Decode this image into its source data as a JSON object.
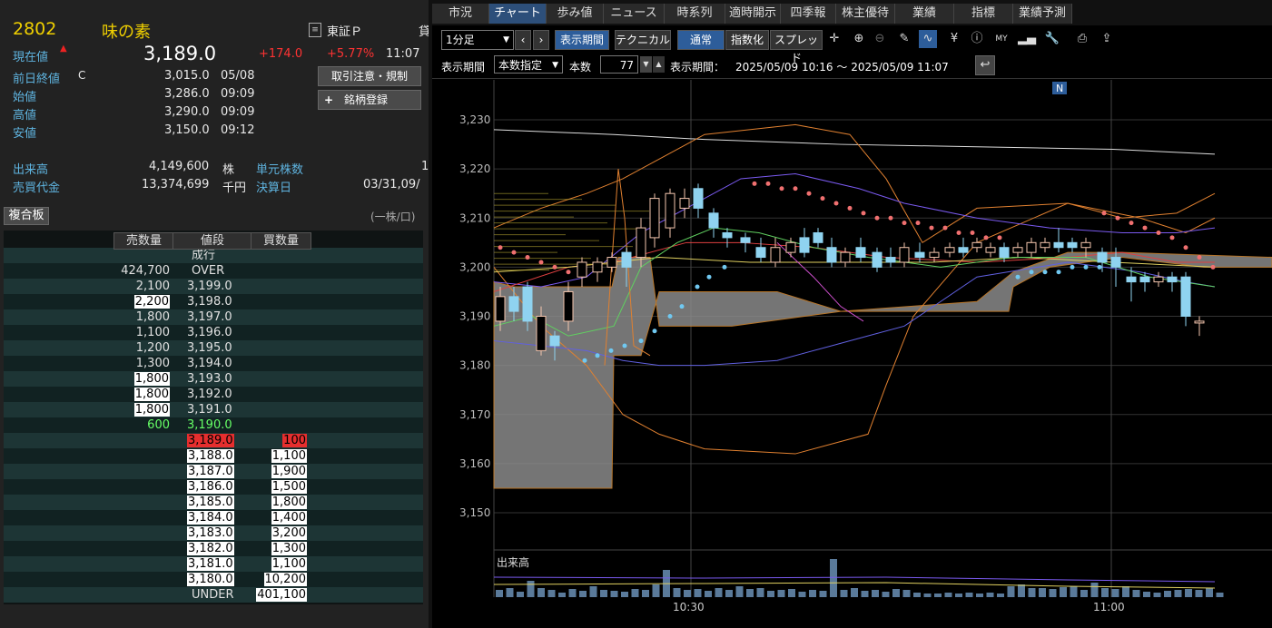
{
  "stock": {
    "code": "2802",
    "name": "味の素",
    "market": "東証Ｐ",
    "market_extra": "貸",
    "current_label": "現在値",
    "current_price": "3,189.0",
    "change": "+174.0",
    "change_pct": "+5.77%",
    "time": "11:07",
    "prev_close_label": "前日終値",
    "prev_close_flag": "C",
    "prev_close": "3,015.0",
    "prev_close_date": "05/08",
    "open_label": "始値",
    "open": "3,286.0",
    "open_time": "09:09",
    "high_label": "高値",
    "high": "3,290.0",
    "high_time": "09:09",
    "low_label": "安値",
    "low": "3,150.0",
    "low_time": "09:12",
    "volume_label": "出来高",
    "volume": "4,149,600",
    "volume_unit": "株",
    "unit_shares_label": "単元株数",
    "unit_shares": "1",
    "turnover_label": "売買代金",
    "turnover": "13,374,699",
    "turnover_unit": "千円",
    "settlement_label": "決算日",
    "settlement": "03/31,09/",
    "btn_notice": "取引注意・規制",
    "btn_register": "銘柄登録",
    "btn_register_icon": "plus-icon"
  },
  "orderbook": {
    "title": "複合板",
    "unit_note": "(一株/口)",
    "headers": {
      "sell": "売数量",
      "price": "値段",
      "buy": "買数量"
    },
    "rows": [
      {
        "sell": "",
        "price": "成行",
        "buy": ""
      },
      {
        "sell": "424,700",
        "price": "OVER",
        "buy": ""
      },
      {
        "sell": "2,100",
        "price": "3,199.0",
        "buy": ""
      },
      {
        "sell": "2,200",
        "price": "3,198.0",
        "buy": "",
        "sbox": true
      },
      {
        "sell": "1,800",
        "price": "3,197.0",
        "buy": ""
      },
      {
        "sell": "1,100",
        "price": "3,196.0",
        "buy": ""
      },
      {
        "sell": "1,200",
        "price": "3,195.0",
        "buy": ""
      },
      {
        "sell": "1,300",
        "price": "3,194.0",
        "buy": ""
      },
      {
        "sell": "1,800",
        "price": "3,193.0",
        "buy": "",
        "sbox": true
      },
      {
        "sell": "1,800",
        "price": "3,192.0",
        "buy": "",
        "sbox": true
      },
      {
        "sell": "1,800",
        "price": "3,191.0",
        "buy": "",
        "sbox": true
      },
      {
        "sell": "600",
        "price": "3,190.0",
        "buy": "",
        "green": true
      },
      {
        "sell": "",
        "price": "3,189.0",
        "buy": "100",
        "red": true
      },
      {
        "sell": "",
        "price": "3,188.0",
        "buy": "1,100",
        "pbox": true,
        "bbox": true
      },
      {
        "sell": "",
        "price": "3,187.0",
        "buy": "1,900",
        "pbox": true,
        "bbox": true
      },
      {
        "sell": "",
        "price": "3,186.0",
        "buy": "1,500",
        "pbox": true,
        "bbox": true
      },
      {
        "sell": "",
        "price": "3,185.0",
        "buy": "1,800",
        "pbox": true,
        "bbox": true
      },
      {
        "sell": "",
        "price": "3,184.0",
        "buy": "1,400",
        "pbox": true,
        "bbox": true
      },
      {
        "sell": "",
        "price": "3,183.0",
        "buy": "3,200",
        "pbox": true,
        "bbox": true
      },
      {
        "sell": "",
        "price": "3,182.0",
        "buy": "1,300",
        "pbox": true,
        "bbox": true
      },
      {
        "sell": "",
        "price": "3,181.0",
        "buy": "1,100",
        "pbox": true,
        "bbox": true
      },
      {
        "sell": "",
        "price": "3,180.0",
        "buy": "10,200",
        "pbox": true,
        "bbox": true
      },
      {
        "sell": "",
        "price": "UNDER",
        "buy": "401,100",
        "bbox": true
      }
    ]
  },
  "tabs": [
    "市況",
    "チャート",
    "歩み値",
    "ニュース",
    "時系列",
    "適時開示",
    "四季報",
    "株主優待",
    "業績",
    "指標",
    "業績予測"
  ],
  "active_tab": 1,
  "toolbar": {
    "interval": "1分足",
    "btn_period": "表示期間",
    "btn_technical": "テクニカル",
    "btn_normal": "通常",
    "btn_index": "指数化",
    "btn_spread": "スプレッド",
    "icons": [
      "crosshair-icon",
      "zoom-in-icon",
      "zoom-out-icon",
      "pencil-icon",
      "trend-icon",
      "yen-icon",
      "info-icon",
      "my-indicator-icon",
      "volume-profile-icon",
      "wrench-icon",
      "print-icon",
      "export-icon"
    ],
    "period_label": "表示期間",
    "period_mode": "本数指定",
    "count_label": "本数",
    "count": "77",
    "range_label": "表示期間：",
    "range_value": "2025/05/09 10:16 ～ 2025/05/09 11:07",
    "news_marker": "N",
    "volume_label": "出来高"
  },
  "chart_data": {
    "type": "candlestick",
    "y_ticks": [
      "3,230",
      "3,220",
      "3,210",
      "3,200",
      "3,190",
      "3,180",
      "3,170",
      "3,160",
      "3,150"
    ],
    "ylim": [
      3148,
      3233
    ],
    "x_ticks": [
      "10:30",
      "11:00"
    ],
    "colors": {
      "up": "#f5c6ae",
      "down": "#8fd3f0",
      "bg": "#000000",
      "cloud": "#8a8a8a"
    }
  }
}
